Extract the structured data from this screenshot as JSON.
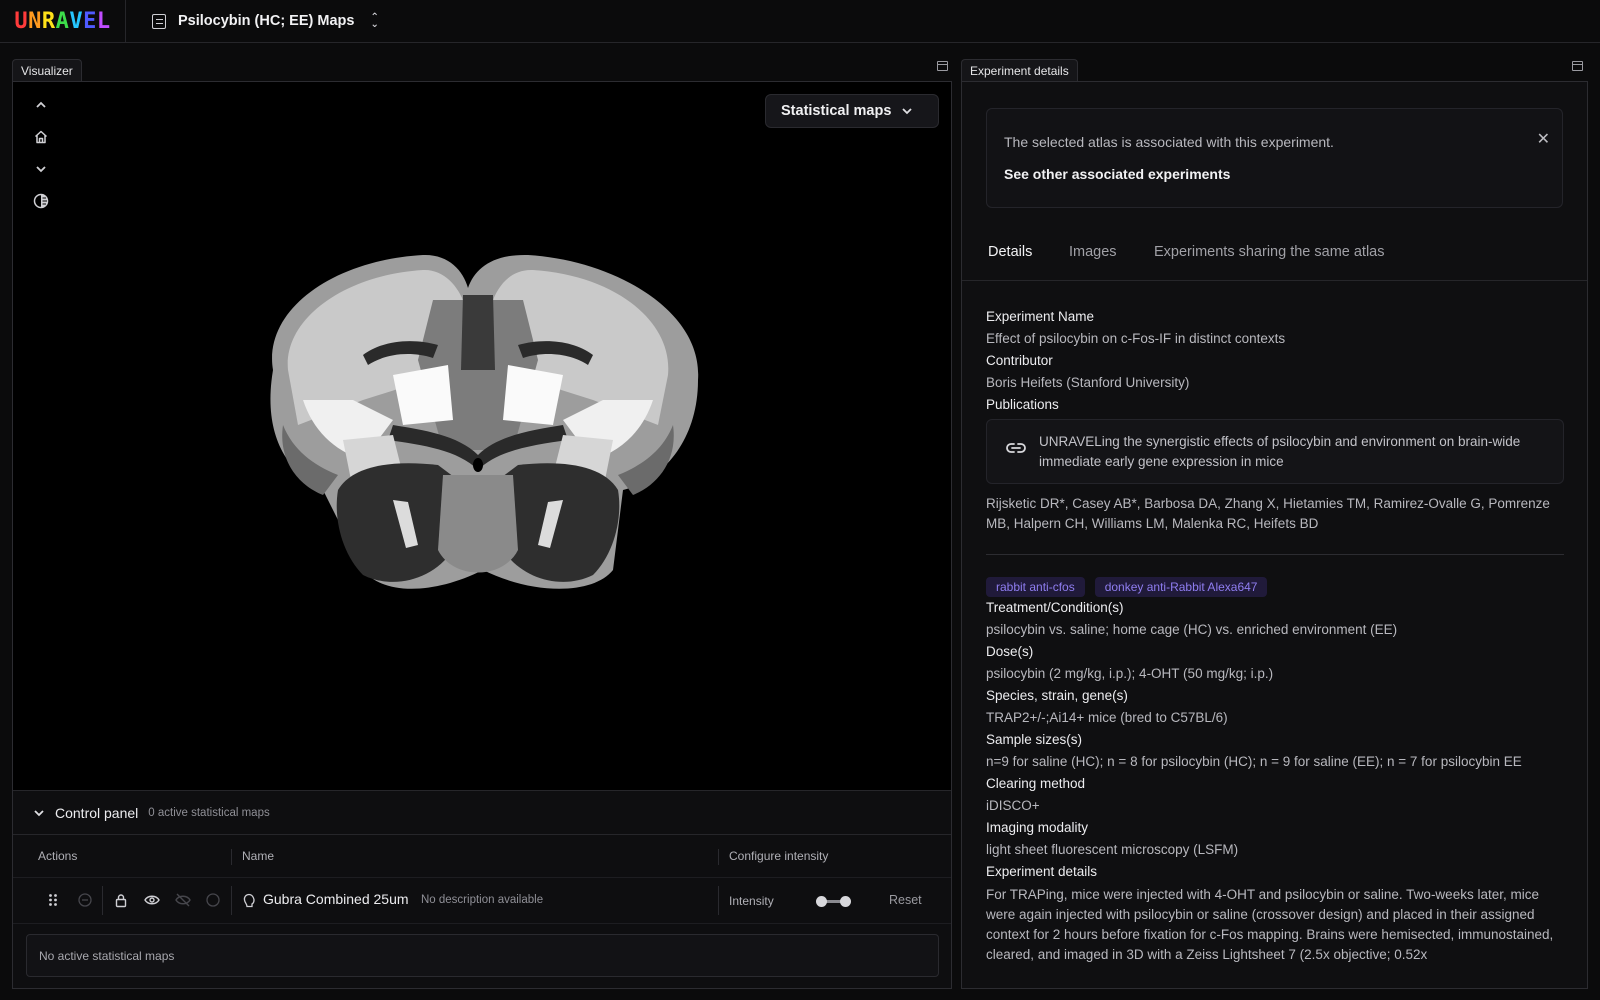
{
  "app": {
    "logo": [
      "U",
      "N",
      "R",
      "A",
      "V",
      "E",
      "L"
    ],
    "logo_colors": [
      "#ff3b3b",
      "#ff9a1f",
      "#ffe11a",
      "#3ddc4a",
      "#26c6ff",
      "#4f5bff",
      "#c04dff"
    ],
    "project_title": "Psilocybin (HC; EE) Maps"
  },
  "visualizer": {
    "tab_label": "Visualizer",
    "stat_button": "Statistical maps",
    "toolbar_icons": [
      "chevron-up-icon",
      "home-icon",
      "chevron-down-icon",
      "contrast-icon"
    ]
  },
  "control_panel": {
    "title": "Control panel",
    "subtitle": "0 active statistical maps",
    "col_actions": "Actions",
    "col_name": "Name",
    "col_intensity": "Configure intensity",
    "row": {
      "name": "Gubra Combined 25um",
      "description": "No description available",
      "intensity_label": "Intensity",
      "reset": "Reset"
    },
    "empty": "No active statistical maps"
  },
  "experiment": {
    "tab_label": "Experiment details",
    "notice_text": "The selected atlas is associated with this experiment.",
    "notice_link": "See other associated experiments",
    "tabs": [
      "Details",
      "Images",
      "Experiments sharing the same atlas"
    ],
    "name_label": "Experiment Name",
    "name_value": "Effect of psilocybin on c-Fos-IF in distinct contexts",
    "contributor_label": "Contributor",
    "contributor_value": "Boris Heifets (Stanford University)",
    "publications_label": "Publications",
    "publication_title": "UNRAVELing the synergistic effects of psilocybin and environment on brain-wide immediate early gene expression in mice",
    "authors": "Rijsketic DR*, Casey AB*, Barbosa DA, Zhang X, Hietamies TM, Ramirez-Ovalle G, Pomrenze MB, Halpern CH, Williams LM, Malenka RC, Heifets BD",
    "tags": [
      "rabbit anti-cfos",
      "donkey anti-Rabbit Alexa647"
    ],
    "treatment_label": "Treatment/Condition(s)",
    "treatment_value": "psilocybin vs. saline; home cage (HC) vs. enriched environment (EE)",
    "dose_label": "Dose(s)",
    "dose_value": "psilocybin (2 mg/kg, i.p.); 4-OHT (50 mg/kg; i.p.)",
    "species_label": "Species, strain, gene(s)",
    "species_value": "TRAP2+/-;Ai14+ mice (bred to C57BL/6)",
    "sample_label": "Sample sizes(s)",
    "sample_value": "n=9 for saline (HC); n = 8 for psilocybin (HC); n = 9 for saline (EE); n = 7 for psilocybin EE",
    "clearing_label": "Clearing method",
    "clearing_value": "iDISCO+",
    "imaging_label": "Imaging modality",
    "imaging_value": "light sheet fluorescent microscopy (LSFM)",
    "details_label": "Experiment details",
    "details_value": "For TRAPing, mice were injected with 4-OHT and psilocybin or saline. Two-weeks later, mice were again injected with psilocybin or saline (crossover design) and placed in their assigned context for 2 hours before fixation for c-Fos mapping. Brains were hemisected, immunostained, cleared, and imaged in 3D with a Zeiss Lightsheet 7 (2.5x objective; 0.52x"
  }
}
